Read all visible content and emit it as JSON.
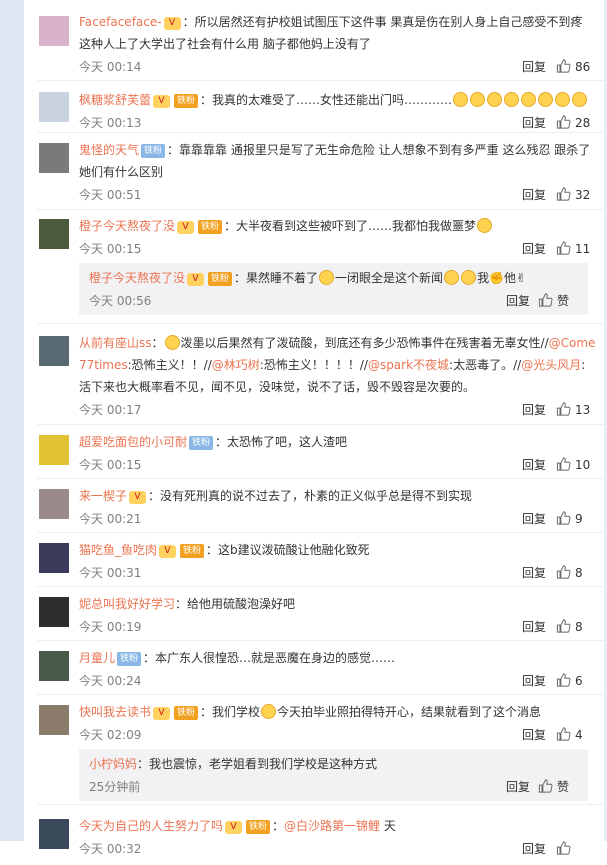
{
  "reply_label": "回复",
  "like_label": "赞",
  "comments": [
    {
      "user": "Facefaceface-",
      "vip": "V",
      "fan": "",
      "parts": [
        ": 所以居然还有护校姐试图压下这件事 果真是伤在别人身上自己感受不到疼 这种人上了大学出了社会有什么用 脑子都他妈让狗吃了"
      ],
      "text": "：所以居然还有护校姐试图压下这件事 果真是伤在别人身上自己感受不到疼 这种人上了大学出了社会有什么用 脑子都他妈上没有了",
      "time": "今天 00:14",
      "likes": "86",
      "avatar": "#d9b3c9"
    },
    {
      "user": "枫糖浆舒芙蕾",
      "vip": "V",
      "fan": "铁粉",
      "text": "：我真的太难受了……女性还能出门吗…………",
      "emojis": 8,
      "time": "今天 00:13",
      "likes": "28",
      "avatar": "#c9d3e0"
    },
    {
      "user": "鬼怪的天气",
      "vip": "",
      "fan": "铁粉",
      "text": "：靠靠靠靠 通报里只是写了无生命危险 让人想象不到有多严重 这么残忍 跟杀了她们有什么区别",
      "time": "今天 00:51",
      "likes": "32",
      "avatar": "#7a7a7a"
    },
    {
      "user": "橙子今天熬夜了没",
      "vip": "V",
      "fan": "铁粉",
      "text": "：大半夜看到这些被吓到了……我都怕我做噩梦",
      "time": "今天 00:15",
      "likes": "11",
      "avatar": "#4a5a3a",
      "sub": {
        "user": "橙子今天熬夜了没",
        "vip": "V",
        "fan": "铁粉",
        "text": "：果然睡不着了",
        "text2": "一闭眼全是这个新闻",
        "text3": "我",
        "text4": "他",
        "time": "今天 00:56"
      }
    },
    {
      "user": "从前有座山ss",
      "vip": "",
      "fan": "",
      "text": "：",
      "text_b": "泼墨以后果然有了泼硫酸，到底还有多少恐怖事件在残害着无辜女性//",
      "m1": "@Come77times",
      "t1": ":恐怖主义！！//",
      "m2": "@林巧树",
      "t2": ":恐怖主义！！！！//",
      "m3": "@spark不夜城",
      "t3": ":太恶毒了。//",
      "m4": "@光头风月",
      "t4": ": 活下来也大概率看不见，闻不见，没味觉，说不了话，毁不毁容是次要的。",
      "time": "今天 00:17",
      "likes": "13",
      "avatar": "#5a6a72"
    },
    {
      "user": "超爱吃面包的小可耐",
      "vip": "",
      "fan": "铁粉",
      "text": "：太恐怖了吧，这人渣吧",
      "time": "今天 00:15",
      "likes": "10",
      "avatar": "#e2c232"
    },
    {
      "user": "来一楔子",
      "vip": "V",
      "fan": "",
      "text": "：没有死刑真的说不过去了，朴素的正义似乎总是得不到实现",
      "time": "今天 00:21",
      "likes": "9",
      "avatar": "#9a8a8a"
    },
    {
      "user": "猫吃鱼_鱼吃肉",
      "vip": "V",
      "fan": "铁粉",
      "text": "：这b建议泼硫酸让他融化致死",
      "time": "今天 00:31",
      "likes": "8",
      "avatar": "#3a3a5a"
    },
    {
      "user": "妮总叫我好好学习",
      "vip": "",
      "fan": "",
      "text": "：给他用硫酸泡澡好吧",
      "time": "今天 00:19",
      "likes": "8",
      "avatar": "#2e2e2e"
    },
    {
      "user": "月童儿",
      "vip": "",
      "fan": "铁粉",
      "text": "：本广东人很惶恐…就是恶魔在身边的感觉……",
      "time": "今天 00:24",
      "likes": "6",
      "avatar": "#4a5a4a"
    },
    {
      "user": "快叫我去读书",
      "vip": "V",
      "fan": "铁粉",
      "text": "：我们学校",
      "text_b": "今天拍毕业照拍得特开心，结果就看到了这个消息",
      "time": "今天 02:09",
      "likes": "4",
      "avatar": "#8a7a6a",
      "sub": {
        "user": "小柠妈妈",
        "text": "：我也震惊，老学姐看到我们学校是这种方式",
        "time": "25分钟前"
      }
    },
    {
      "user": "今天为自己的人生努力了吗",
      "vip": "V",
      "fan": "铁粉",
      "text": "：",
      "m1": "@白沙路第一锦鲤",
      "t1": " 天",
      "time": "今天 00:32",
      "likes": "",
      "avatar": "#3a4a5a"
    }
  ]
}
